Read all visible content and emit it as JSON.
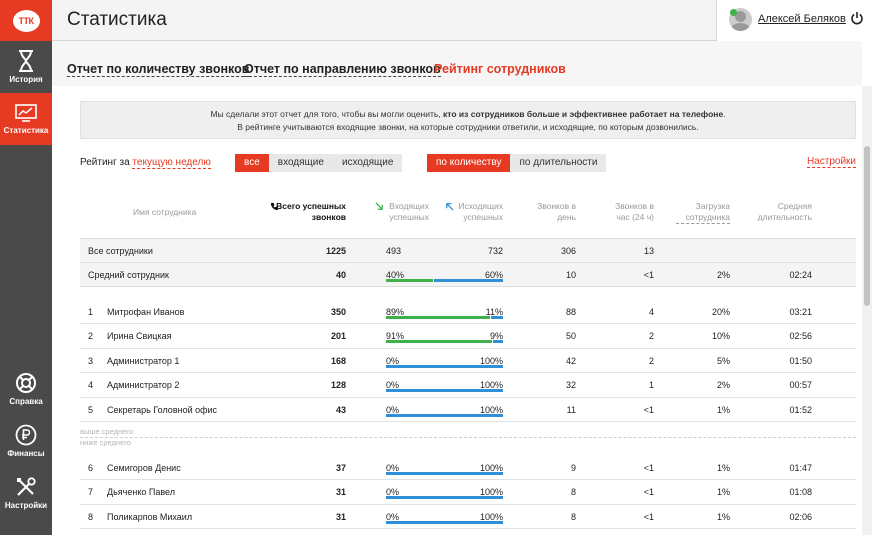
{
  "header": {
    "title": "Статистика",
    "user_name": "Алексей Беляков",
    "logo_text": "ТТК"
  },
  "sidebar": {
    "items": [
      {
        "label": "История",
        "icon": "hourglass-icon"
      },
      {
        "label": "Статистика",
        "icon": "chart-icon"
      },
      {
        "label": "Справка",
        "icon": "lifebuoy-icon"
      },
      {
        "label": "Финансы",
        "icon": "ruble-icon"
      },
      {
        "label": "Настройки",
        "icon": "tools-icon"
      }
    ]
  },
  "tabs": [
    {
      "label": "Отчет по количеству звонков"
    },
    {
      "label": "Отчет по направлению звонков"
    },
    {
      "label": "Рейтинг сотрудников"
    }
  ],
  "info": {
    "line1_pre": "Мы сделали этот отчет для того, чтобы вы могли оценить, ",
    "line1_bold": "кто из сотрудников больше и эффективнее работает на телефоне",
    "line1_post": ".",
    "line2": "В рейтинге учитываются входящие звонки, на которые сотрудники ответили, и исходящие, по которым дозвонились."
  },
  "filters": {
    "label": "Рейтинг за ",
    "period_link": "текущую неделю",
    "direction": [
      "все",
      "входящие",
      "исходящие"
    ],
    "sort": [
      "по количеству",
      "по длительности"
    ],
    "settings": "Настройки"
  },
  "columns": {
    "name": "Имя сотрудника",
    "total": "Всего успешных звонков",
    "incoming": "Входящих успешных",
    "outgoing": "Исходящих успешных",
    "per_day": "Звонков в день",
    "per_hour": "Звонков в час (24 ч)",
    "load": "Загрузка сотрудника",
    "avg_duration": "Средняя длительность"
  },
  "summary": [
    {
      "name": "Все сотрудники",
      "total": "1225",
      "incoming": "493",
      "outgoing": "732",
      "per_day": "306",
      "per_hour": "13",
      "load": "",
      "avg": ""
    },
    {
      "name": "Средний сотрудник",
      "total": "40",
      "incoming": "40%",
      "outgoing": "60%",
      "per_day": "10",
      "per_hour": "<1",
      "load": "2%",
      "avg": "02:24",
      "in_frac": 0.4
    }
  ],
  "above_rows": [
    {
      "num": "1",
      "name": "Митрофан Иванов",
      "total": "350",
      "incoming": "89%",
      "outgoing": "11%",
      "per_day": "88",
      "per_hour": "4",
      "load": "20%",
      "avg": "03:21",
      "in_frac": 0.89
    },
    {
      "num": "2",
      "name": "Ирина Свицкая",
      "total": "201",
      "incoming": "91%",
      "outgoing": "9%",
      "per_day": "50",
      "per_hour": "2",
      "load": "10%",
      "avg": "02:56",
      "in_frac": 0.91
    },
    {
      "num": "3",
      "name": "Администратор 1",
      "total": "168",
      "incoming": "0%",
      "outgoing": "100%",
      "per_day": "42",
      "per_hour": "2",
      "load": "5%",
      "avg": "01:50",
      "in_frac": 0
    },
    {
      "num": "4",
      "name": "Администратор 2",
      "total": "128",
      "incoming": "0%",
      "outgoing": "100%",
      "per_day": "32",
      "per_hour": "1",
      "load": "2%",
      "avg": "00:57",
      "in_frac": 0
    },
    {
      "num": "5",
      "name": "Секретарь Головной офис",
      "total": "43",
      "incoming": "0%",
      "outgoing": "100%",
      "per_day": "11",
      "per_hour": "<1",
      "load": "1%",
      "avg": "01:52",
      "in_frac": 0
    }
  ],
  "divider": {
    "above": "выше среднего",
    "below": "ниже среднего"
  },
  "below_rows": [
    {
      "num": "6",
      "name": "Семигоров Денис",
      "total": "37",
      "incoming": "0%",
      "outgoing": "100%",
      "per_day": "9",
      "per_hour": "<1",
      "load": "1%",
      "avg": "01:47",
      "in_frac": 0
    },
    {
      "num": "7",
      "name": "Дьяченко Павел",
      "total": "31",
      "incoming": "0%",
      "outgoing": "100%",
      "per_day": "8",
      "per_hour": "<1",
      "load": "1%",
      "avg": "01:08",
      "in_frac": 0
    },
    {
      "num": "8",
      "name": "Поликарпов Михаил",
      "total": "31",
      "incoming": "0%",
      "outgoing": "100%",
      "per_day": "8",
      "per_hour": "<1",
      "load": "1%",
      "avg": "02:06",
      "in_frac": 0
    }
  ],
  "colors": {
    "accent": "#e63a23",
    "sidebar": "#4a4a4a",
    "incoming": "#3fb14b",
    "outgoing": "#2f8fd8"
  }
}
